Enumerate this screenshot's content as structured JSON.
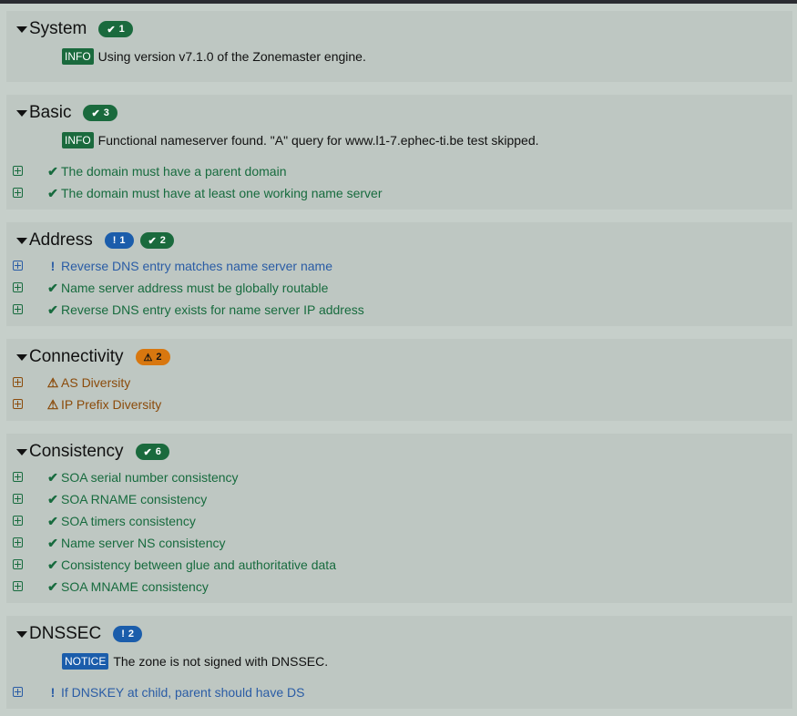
{
  "colors": {
    "ok": "#1a6a3d",
    "notice": "#1b5dab",
    "warning": "#d8770f"
  },
  "sections": [
    {
      "title": "System",
      "badges": [
        {
          "level": "ok",
          "icon": "check-icon",
          "count": "1"
        }
      ],
      "messages": [
        {
          "tag": "INFO",
          "level": "info",
          "text": "Using version v7.1.0 of the Zonemaster engine."
        }
      ],
      "items": []
    },
    {
      "title": "Basic",
      "badges": [
        {
          "level": "ok",
          "icon": "check-icon",
          "count": "3"
        }
      ],
      "messages": [
        {
          "tag": "INFO",
          "level": "info",
          "text": "Functional nameserver found. \"A\" query for www.l1-7.ephec-ti.be test skipped."
        }
      ],
      "items": [
        {
          "level": "ok",
          "icon": "check-icon",
          "text": "The domain must have a parent domain"
        },
        {
          "level": "ok",
          "icon": "check-icon",
          "text": "The domain must have at least one working name server"
        }
      ]
    },
    {
      "title": "Address",
      "badges": [
        {
          "level": "notice",
          "icon": "exclamation-icon",
          "count": "1"
        },
        {
          "level": "ok",
          "icon": "check-icon",
          "count": "2"
        }
      ],
      "messages": [],
      "items": [
        {
          "level": "notice",
          "icon": "exclamation-icon",
          "text": "Reverse DNS entry matches name server name"
        },
        {
          "level": "ok",
          "icon": "check-icon",
          "text": "Name server address must be globally routable"
        },
        {
          "level": "ok",
          "icon": "check-icon",
          "text": "Reverse DNS entry exists for name server IP address"
        }
      ]
    },
    {
      "title": "Connectivity",
      "badges": [
        {
          "level": "warn",
          "icon": "warning-icon",
          "count": "2"
        }
      ],
      "messages": [],
      "items": [
        {
          "level": "warn",
          "icon": "warning-icon",
          "text": "AS Diversity"
        },
        {
          "level": "warn",
          "icon": "warning-icon",
          "text": "IP Prefix Diversity"
        }
      ]
    },
    {
      "title": "Consistency",
      "badges": [
        {
          "level": "ok",
          "icon": "check-icon",
          "count": "6"
        }
      ],
      "messages": [],
      "items": [
        {
          "level": "ok",
          "icon": "check-icon",
          "text": "SOA serial number consistency"
        },
        {
          "level": "ok",
          "icon": "check-icon",
          "text": "SOA RNAME consistency"
        },
        {
          "level": "ok",
          "icon": "check-icon",
          "text": "SOA timers consistency"
        },
        {
          "level": "ok",
          "icon": "check-icon",
          "text": "Name server NS consistency"
        },
        {
          "level": "ok",
          "icon": "check-icon",
          "text": "Consistency between glue and authoritative data"
        },
        {
          "level": "ok",
          "icon": "check-icon",
          "text": "SOA MNAME consistency"
        }
      ]
    },
    {
      "title": "DNSSEC",
      "badges": [
        {
          "level": "notice",
          "icon": "exclamation-icon",
          "count": "2"
        }
      ],
      "messages": [
        {
          "tag": "NOTICE",
          "level": "notice",
          "text": "The zone is not signed with DNSSEC."
        }
      ],
      "items": [
        {
          "level": "notice",
          "icon": "exclamation-icon",
          "text": "If DNSKEY at child, parent should have DS"
        }
      ]
    }
  ]
}
